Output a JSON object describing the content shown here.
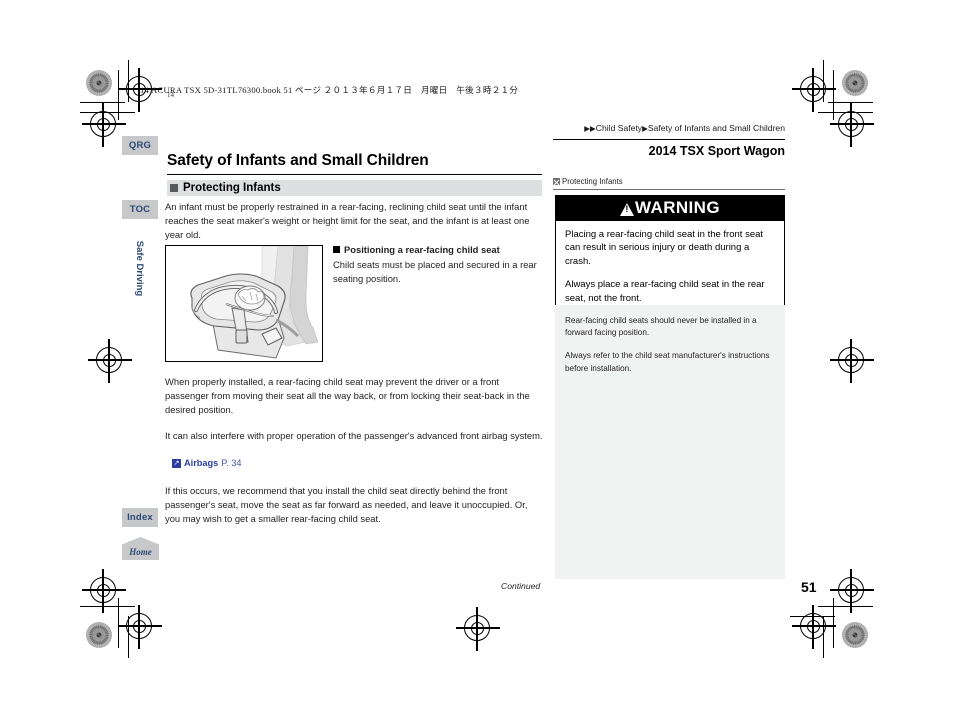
{
  "document": {
    "imprint": "14 ACURA TSX 5D-31TL76300.book  51 ページ  ２０１３年６月１７日　月曜日　午後３時２１分",
    "page_number": "51",
    "continued_label": "Continued",
    "reg_label": "14"
  },
  "header": {
    "breadcrumb_sep": "▶",
    "breadcrumb_part1": "Child Safety",
    "breadcrumb_part2": "Safety of Infants and Small Children",
    "model_name": "2014 TSX Sport Wagon"
  },
  "tabs": {
    "qrg": "QRG",
    "toc": "TOC",
    "section": "Safe Driving",
    "index": "Index",
    "home": "Home"
  },
  "main": {
    "title": "Safety of Infants and Small Children",
    "subhead": "Protecting Infants",
    "paragraph_1": "An infant must be properly restrained in a rear-facing, reclining child seat until the infant reaches the seat maker's weight or height limit for the seat, and the infant is at least one year old.",
    "figure_caption_head": "Positioning a rear-facing child seat",
    "figure_caption_body": "Child seats must be placed and secured in a rear seating position.",
    "paragraph_2": "When properly installed, a rear-facing child seat may prevent the driver or a front passenger from moving their seat all the way back, or from locking their seat-back in the desired position.",
    "paragraph_3": "It can also interfere with proper operation of the passenger's advanced front airbag system.",
    "link_target": "Airbags",
    "link_page": "P. 34",
    "link_icon": "jump-arrow-icon",
    "paragraph_4": "If this occurs, we recommend that you install the child seat directly behind the front passenger's seat, move the seat as far forward as needed, and leave it unoccupied. Or, you may wish to get a smaller rear-facing child seat."
  },
  "sidebar": {
    "note_head": "Protecting Infants",
    "warning_title": "WARNING",
    "warning_paragraph_1": "Placing a rear-facing child seat in the front seat can result in serious injury or death during a crash.",
    "warning_paragraph_2": "Always place a rear-facing child seat in the rear seat, not the front.",
    "note_paragraph_1": "Rear-facing child seats should never be installed in a forward facing position.",
    "note_paragraph_2": "Always refer to the child seat manufacturer's instructions before installation."
  },
  "colors": {
    "tab_bg": "#c6c8ca",
    "tab_text": "#2c4a78",
    "link": "#2b3fa0",
    "warning_bg": "#000000",
    "side_panel_bg": "#f1f2f2",
    "subhead_bg": "#dedfe1"
  }
}
